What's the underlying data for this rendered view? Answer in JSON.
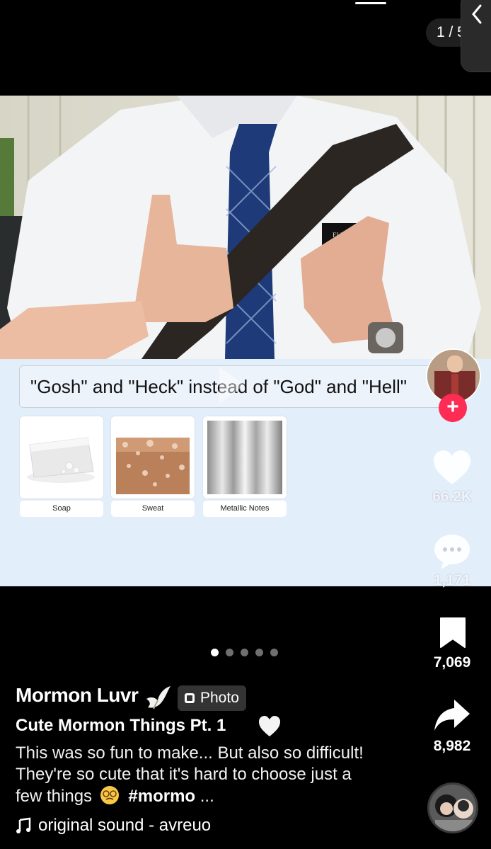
{
  "top": {
    "page_counter": "1 / 5"
  },
  "headline": "\"Gosh\" and \"Heck\" instead of \"God\" and \"Hell\"",
  "cards": [
    {
      "label": "Soap",
      "icon": "soap-image"
    },
    {
      "label": "Sweat",
      "icon": "sweat-image"
    },
    {
      "label": "Metallic Notes",
      "icon": "metallic-image"
    }
  ],
  "rail": {
    "likes": "66.2K",
    "comments": "1,171",
    "saves": "7,069",
    "shares": "8,982"
  },
  "carousel": {
    "total": 5,
    "active": 1
  },
  "post": {
    "author": "Mormon Luvr",
    "badge": "Photo",
    "title": "Cute Mormon Things Pt. 1",
    "desc_text": "This was so fun to make... But also so difficult! They're so cute that it's hard to choose just a few things",
    "hashtag": "#mormo",
    "ellipsis": "...",
    "sound": "original sound - avreuo"
  },
  "colors": {
    "follow": "#fe2c55",
    "panel": "#e3eefb"
  }
}
